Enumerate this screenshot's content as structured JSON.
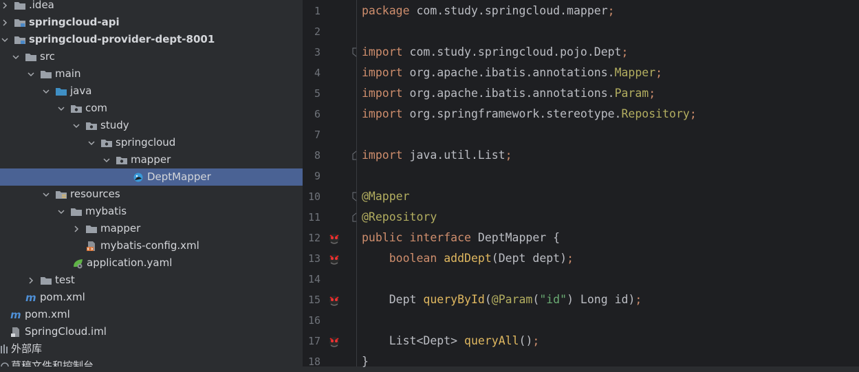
{
  "colors": {
    "panel_bg": "#2b2d30",
    "editor_bg": "#1e1f22",
    "selection": "#4a6294",
    "keyword": "#cf8e6d",
    "annotation": "#b3ae60",
    "string": "#6aab73",
    "method": "#e0b860",
    "line_number": "#6f737a"
  },
  "project_tree": {
    "items": [
      {
        "label": ".idea",
        "icon": "folder-icon"
      },
      {
        "label": "springcloud-api",
        "icon": "module-folder-icon"
      },
      {
        "label": "springcloud-provider-dept-8001",
        "icon": "module-folder-icon"
      },
      {
        "label": "src",
        "icon": "folder-icon"
      },
      {
        "label": "main",
        "icon": "folder-icon"
      },
      {
        "label": "java",
        "icon": "source-folder-icon"
      },
      {
        "label": "com",
        "icon": "package-icon"
      },
      {
        "label": "study",
        "icon": "package-icon"
      },
      {
        "label": "springcloud",
        "icon": "package-icon"
      },
      {
        "label": "mapper",
        "icon": "package-icon"
      },
      {
        "label": "DeptMapper",
        "icon": "mybatis-interface-icon"
      },
      {
        "label": "resources",
        "icon": "resources-folder-icon"
      },
      {
        "label": "mybatis",
        "icon": "folder-icon"
      },
      {
        "label": "mapper",
        "icon": "folder-icon"
      },
      {
        "label": "mybatis-config.xml",
        "icon": "xml-file-icon"
      },
      {
        "label": "application.yaml",
        "icon": "spring-config-icon"
      },
      {
        "label": "test",
        "icon": "folder-icon"
      },
      {
        "label": "pom.xml",
        "icon": "maven-icon"
      },
      {
        "label": "pom.xml",
        "icon": "maven-icon"
      },
      {
        "label": "SpringCloud.iml",
        "icon": "iml-file-icon"
      },
      {
        "label": "外部库",
        "icon": "library-icon"
      },
      {
        "label": "草稿文件和控制台",
        "icon": "scratch-icon"
      }
    ]
  },
  "editor": {
    "line_numbers": [
      "1",
      "2",
      "3",
      "4",
      "5",
      "6",
      "7",
      "8",
      "9",
      "10",
      "11",
      "12",
      "13",
      "14",
      "15",
      "16",
      "17",
      "18"
    ],
    "tokens": {
      "package_kw": "package",
      "package_name": " com.study.springcloud.mapper",
      "semicolon": ";",
      "import_kw": "import",
      "imp1": " com.study.springcloud.pojo.Dept",
      "imp2_pre": " org.apache.ibatis.annotations.",
      "imp2_cls": "Mapper",
      "imp3_pre": " org.apache.ibatis.annotations.",
      "imp3_cls": "Param",
      "imp4_pre": " org.springframework.stereotype.",
      "imp4_cls": "Repository",
      "imp5": " java.util.List",
      "ann_mapper": "@Mapper",
      "ann_repository": "@Repository",
      "public_kw": "public",
      "interface_kw": "interface",
      "class_name": " DeptMapper {",
      "boolean_kw": "boolean",
      "m1_name": "addDept",
      "m1_params": "(Dept dept)",
      "m2_ret": "Dept ",
      "m2_name": "queryById",
      "m2_open": "(",
      "m2_ann": "@Param",
      "m2_paren": "(",
      "m2_str": "\"id\"",
      "m2_rest": ") Long id)",
      "m3_ret": "List<Dept> ",
      "m3_name": "queryAll",
      "m3_params": "()",
      "close_brace": "}"
    }
  }
}
